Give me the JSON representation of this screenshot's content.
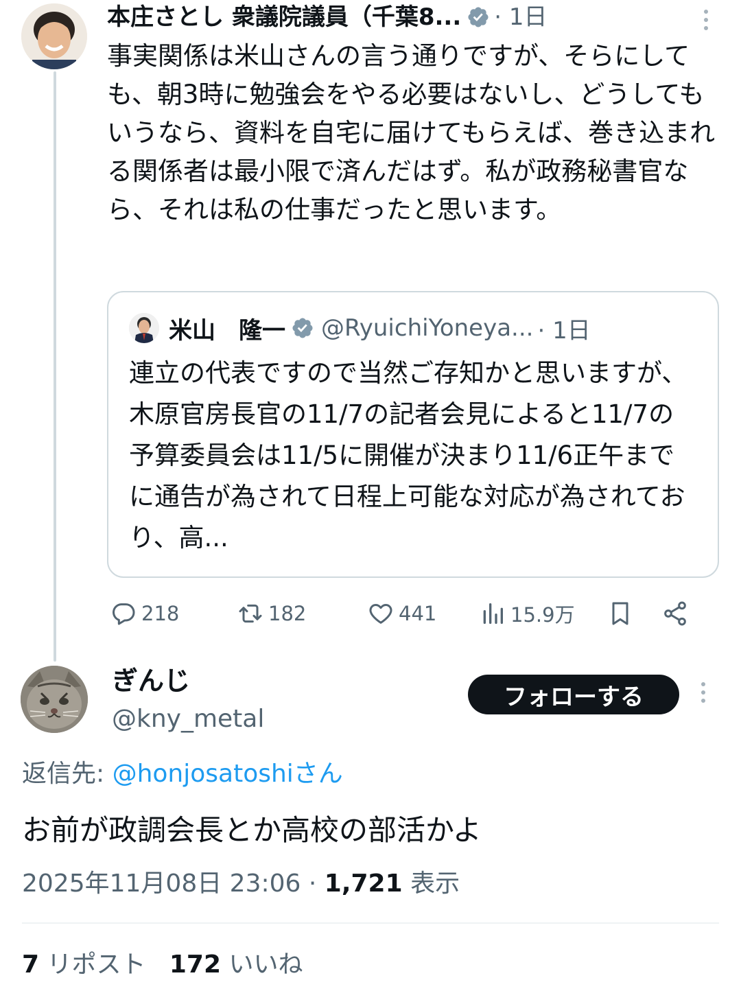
{
  "parent_tweet": {
    "author_name": "本庄さとし 衆議院議員（千葉8...",
    "time": "· 1日",
    "text": "事実関係は米山さんの言う通りですが、そらにしても、朝3時に勉強会をやる必要はないし、どうしてもいうなら、資料を自宅に届けてもらえば、巻き込まれる関係者は最小限で済んだはず。私が政務秘書官なら、それは私の仕事だったと思います。",
    "quote": {
      "author_name": "米山　隆一",
      "handle": "@RyuichiYoneya...",
      "time": "· 1日",
      "text": "連立の代表ですので当然ご存知かと思いますが、木原官房長官の11/7の記者会見によると11/7の予算委員会は11/5に開催が決まり11/6正午までに通告が為されて日程上可能な対応が為されており、高..."
    },
    "actions": {
      "replies": "218",
      "reposts": "182",
      "likes": "441",
      "views": "15.9万"
    }
  },
  "reply_tweet": {
    "author_name": "ぎんじ",
    "handle": "@kny_metal",
    "follow_label": "フォローする",
    "reply_to_prefix": "返信先: ",
    "reply_to_mention": "@honjosatoshiさん",
    "text": "お前が政調会長とか高校の部活かよ",
    "timestamp": "2025年11月08日 23:06 · ",
    "view_count": "1,721",
    "view_label": " 表示",
    "repost_count": "7",
    "repost_label": " リポスト",
    "like_count": "172",
    "like_label": " いいね"
  },
  "colors": {
    "text": "#0f1419",
    "secondary": "#536471",
    "link": "#1d9bf0",
    "border": "#cfd9de",
    "verified": "#829aab"
  }
}
